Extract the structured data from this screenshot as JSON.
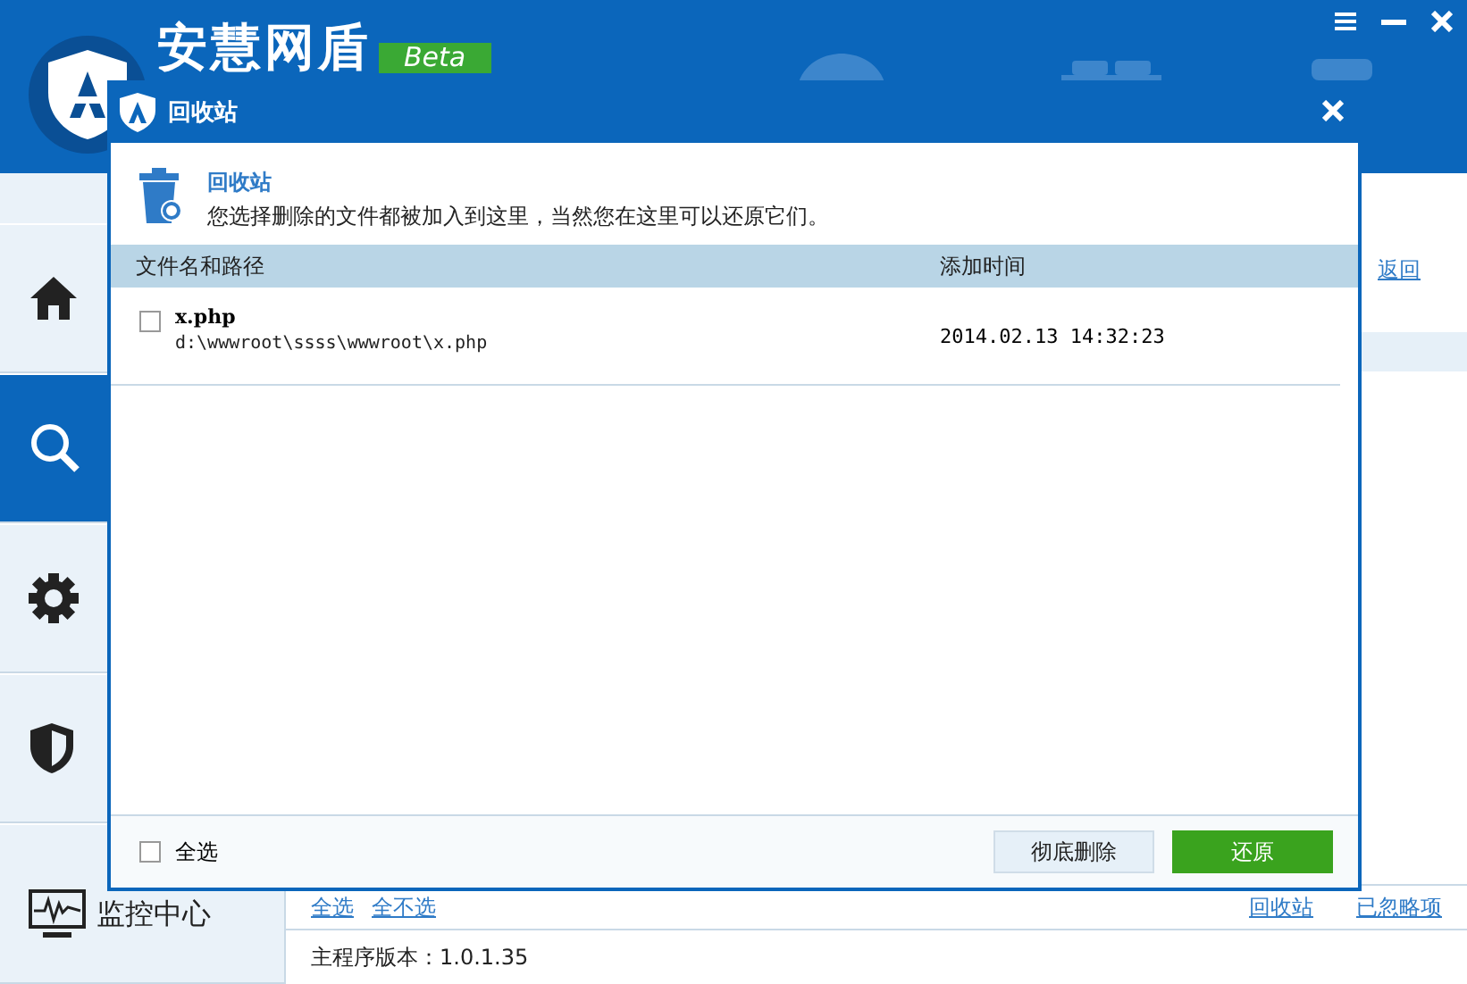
{
  "app": {
    "title": "安慧网盾",
    "badge": "Beta",
    "sidebar": {
      "items": [
        {
          "kind": "home",
          "selected": false
        },
        {
          "kind": "search",
          "selected": true
        },
        {
          "kind": "gear",
          "selected": false
        },
        {
          "kind": "shield",
          "selected": false
        },
        {
          "kind": "monitor",
          "selected": false,
          "label": "监控中心"
        }
      ]
    },
    "main": {
      "back_link": "返回",
      "left_links": [
        "全选",
        "全不选"
      ],
      "right_links": [
        "回收站",
        "已忽略项"
      ],
      "version": "主程序版本：1.0.1.35"
    }
  },
  "dialog": {
    "title": "回收站",
    "heading": "回收站",
    "description": "您选择删除的文件都被加入到这里，当然您在这里可以还原它们。",
    "columns": [
      "文件名和路径",
      "添加时间"
    ],
    "rows": [
      {
        "name": "x.php",
        "path": "d:\\wwwroot\\ssss\\wwwroot\\x.php",
        "time": "2014.02.13 14:32:23",
        "checked": false
      }
    ],
    "select_all": {
      "label": "全选",
      "checked": false
    },
    "buttons": [
      {
        "label": "彻底删除",
        "kind": "secondary"
      },
      {
        "label": "还原",
        "kind": "primary"
      }
    ]
  }
}
